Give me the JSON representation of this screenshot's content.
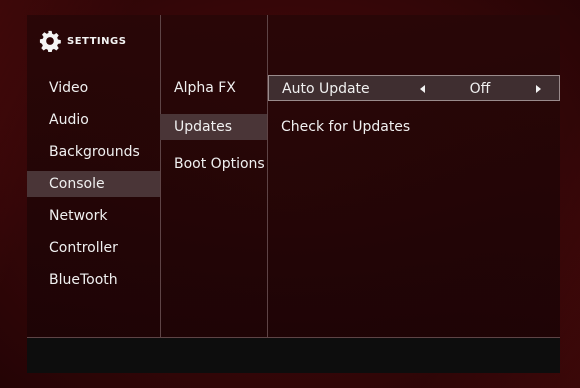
{
  "header": {
    "title": "SETTINGS",
    "icon": "gear-icon"
  },
  "categories": [
    {
      "label": "Video",
      "selected": false
    },
    {
      "label": "Audio",
      "selected": false
    },
    {
      "label": "Backgrounds",
      "selected": false
    },
    {
      "label": "Console",
      "selected": true
    },
    {
      "label": "Network",
      "selected": false
    },
    {
      "label": "Controller",
      "selected": false
    },
    {
      "label": "BlueTooth",
      "selected": false
    }
  ],
  "subcategories": [
    {
      "label": "Alpha FX",
      "selected": false
    },
    {
      "label": "Updates",
      "selected": true
    },
    {
      "label": "Boot Options",
      "selected": false
    }
  ],
  "options": {
    "auto_update": {
      "label": "Auto Update",
      "value": "Off"
    },
    "check_updates": {
      "label": "Check for Updates"
    }
  },
  "colors": {
    "selected_bg": "#4a3537",
    "accent_red": "#5a0d10",
    "footer_bg": "#0d0d0d"
  }
}
